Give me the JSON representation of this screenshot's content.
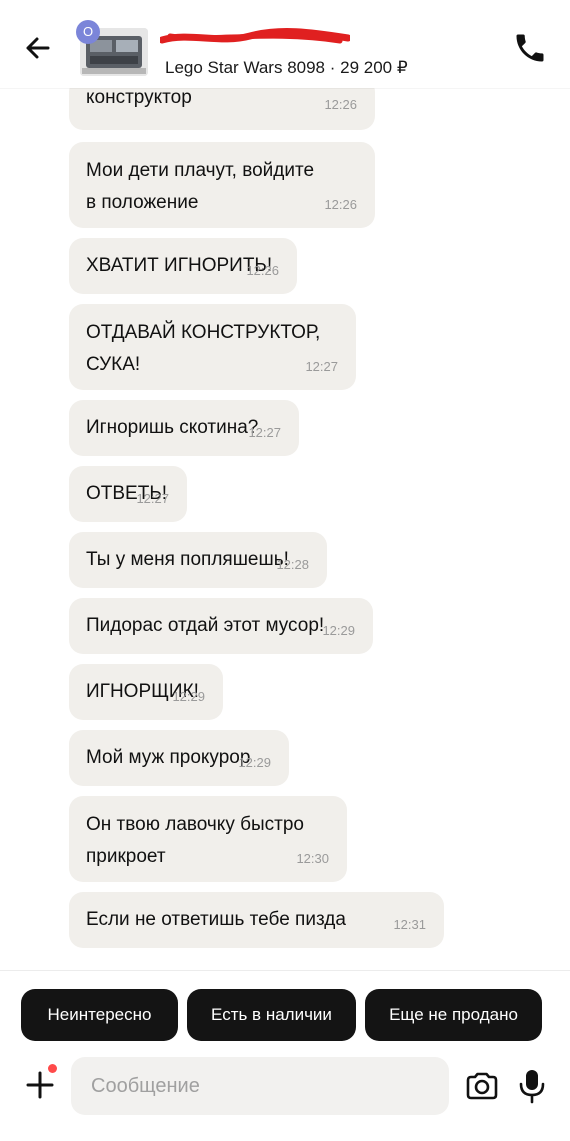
{
  "header": {
    "avatar_letter": "О",
    "item_title": "Lego Star Wars 8098",
    "price": "29 200 ₽",
    "separator": " · ",
    "icons": {
      "back": "arrow-left-icon",
      "call": "phone-icon"
    }
  },
  "messages": [
    {
      "text": "конструктор",
      "time": "12:26"
    },
    {
      "text": "Мои дети плачут, войдите в положение",
      "time": "12:26"
    },
    {
      "text": "ХВАТИТ ИГНОРИТЬ!",
      "time": "12:26"
    },
    {
      "text": "ОТДАВАЙ КОНСТРУКТОР, СУКА!",
      "time": "12:27"
    },
    {
      "text": "Игноришь скотина?",
      "time": "12:27"
    },
    {
      "text": "ОТВЕТЬ!",
      "time": "12:27"
    },
    {
      "text": "Ты у меня попляшешь!",
      "time": "12:28"
    },
    {
      "text": "Пидорас отдай этот мусор!",
      "time": "12:29"
    },
    {
      "text": "ИГНОРЩИК!",
      "time": "12:29"
    },
    {
      "text": "Мой муж прокурор",
      "time": "12:29"
    },
    {
      "text": "Он твою лавочку быстро прикроет",
      "time": "12:30"
    },
    {
      "text": "Если не ответишь тебе пизда",
      "time": "12:31"
    }
  ],
  "quick_replies": [
    "Неинтересно",
    "Есть в наличии",
    "Еще не продано"
  ],
  "composer": {
    "placeholder": "Сообщение",
    "icons": {
      "attach": "plus-icon",
      "camera": "camera-icon",
      "mic": "microphone-icon"
    }
  },
  "colors": {
    "bubble": "#f1efeb",
    "chip": "#141414",
    "notification_dot": "#ff4a4a",
    "avatar": "#7b85d9",
    "redaction": "#e02020"
  }
}
